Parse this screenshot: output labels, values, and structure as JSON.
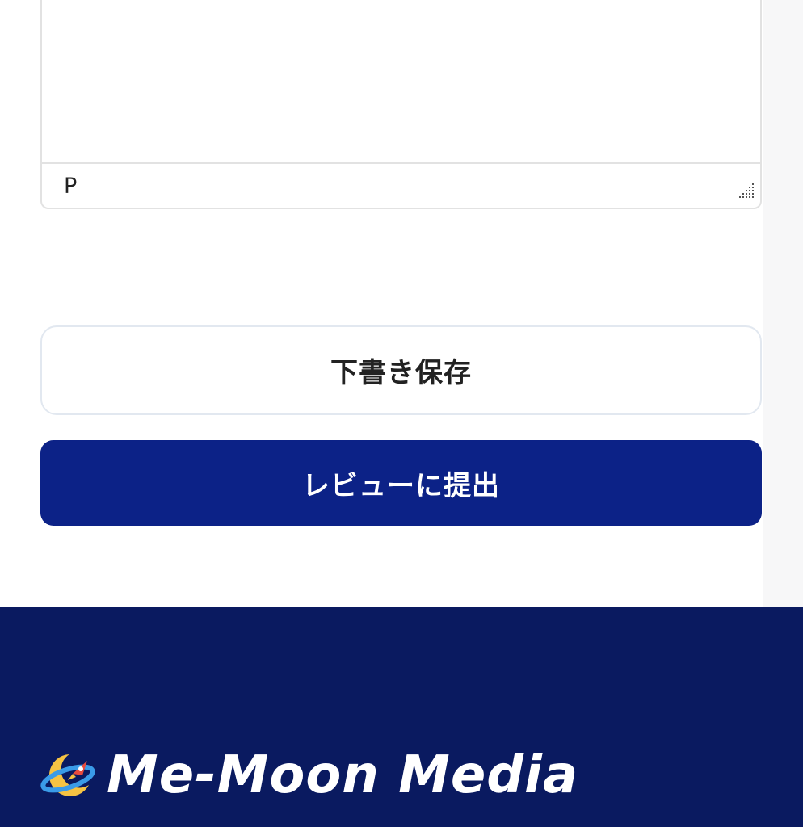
{
  "editor": {
    "element_path": "P"
  },
  "actions": {
    "draft_label": "下書き保存",
    "submit_label": "レビューに提出"
  },
  "footer": {
    "brand_name": "Me-Moon Media"
  },
  "colors": {
    "primary": "#0c2287",
    "footer_bg": "#0a1a60",
    "logo_moon": "#f6c343",
    "logo_ring": "#3a9be8"
  }
}
